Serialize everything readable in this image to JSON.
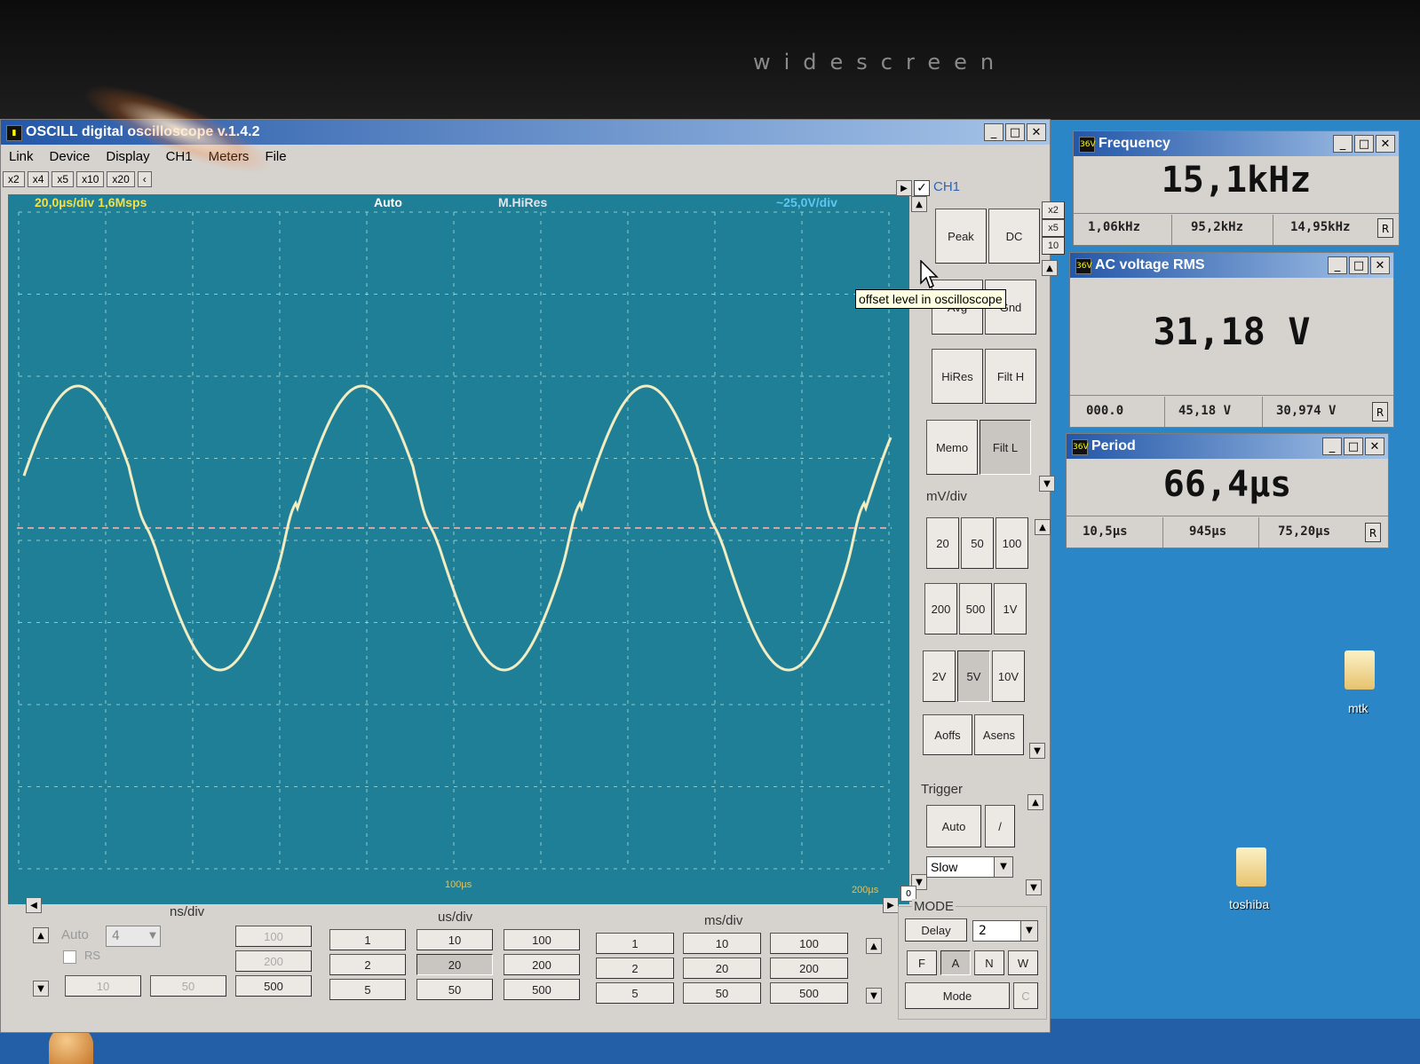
{
  "bezel_text": "widescreen",
  "main_window": {
    "title": "OSCILL digital oscilloscope  v.1.4.2",
    "menu": [
      "Link",
      "Device",
      "Display",
      "CH1",
      "Meters",
      "File"
    ],
    "zoom_buttons": [
      "x2",
      "x4",
      "x5",
      "x10",
      "x20"
    ],
    "zoom_arrow": "‹",
    "status": {
      "timebase": "20,0µs/div  1,6Msps",
      "trigger": "Auto",
      "mode": "M.HiRes",
      "voltage": "~25,0V/div"
    },
    "scope": {
      "bottom_label_1": "100µs",
      "bottom_label_2": "200µs"
    },
    "channel_panel": {
      "ch_label": "CH1",
      "buttons": {
        "peak": "Peak",
        "dc": "DC",
        "avg": "Avg",
        "gnd": "Gnd",
        "hires": "HiRes",
        "filt_h": "Filt H",
        "memo": "Memo",
        "filt_l": "Filt L"
      },
      "mult_buttons": [
        "x2",
        "x5",
        "10"
      ],
      "mv_div_label": "mV/div",
      "mv_buttons": [
        "20",
        "50",
        "100",
        "200",
        "500",
        "1V",
        "2V",
        "5V",
        "10V"
      ],
      "aoffs": "Aoffs",
      "asens": "Asens",
      "trigger_label": "Trigger",
      "trigger_auto": "Auto",
      "trigger_slope": "/",
      "trigger_speed": "Slow",
      "offset_value": "0"
    },
    "tooltip": "offset level in oscilloscope",
    "bottom_panel": {
      "ns_label": "ns/div",
      "us_label": "us/div",
      "ms_label": "ms/div",
      "auto_label": "Auto",
      "auto_value": "4",
      "rs_label": "RS",
      "ns_buttons": [
        "100",
        "200",
        "500",
        "10",
        "50"
      ],
      "us_buttons": [
        "1",
        "10",
        "100",
        "2",
        "20",
        "200",
        "5",
        "50",
        "500"
      ],
      "ms_buttons": [
        "1",
        "10",
        "100",
        "2",
        "20",
        "200",
        "5",
        "50",
        "500"
      ],
      "mode_label": "MODE",
      "delay": "Delay",
      "delay_value": "2",
      "fanw": [
        "F",
        "A",
        "N",
        "W"
      ],
      "mode_button": "Mode",
      "c_button": "C"
    }
  },
  "meters": {
    "frequency": {
      "title": "Frequency",
      "value": "15,1kHz",
      "cells": [
        "1,06kHz",
        "95,2kHz",
        "14,95kHz"
      ]
    },
    "ac_voltage": {
      "title": "AC voltage RMS",
      "value": "31,18 V",
      "cells": [
        "000.0",
        "45,18 V",
        "30,974 V"
      ]
    },
    "period": {
      "title": "Period",
      "value": "66,4µs",
      "cells": [
        "10,5µs",
        "945µs",
        "75,20µs"
      ]
    },
    "reset_label": "R",
    "icon_label": "36V"
  },
  "window_buttons": {
    "minimize": "_",
    "maximize": "□",
    "close": "✕"
  },
  "desktop_icons": [
    {
      "label": "mtk"
    },
    {
      "label": "toshiba"
    }
  ],
  "colors": {
    "scope_bg": "#1f7f97",
    "trace": "#f2ecc0",
    "grid": "#a8ded8",
    "offset_line": "#e0a0a0",
    "titlebar": "#2357a8",
    "desktop": "#2a86c6"
  }
}
